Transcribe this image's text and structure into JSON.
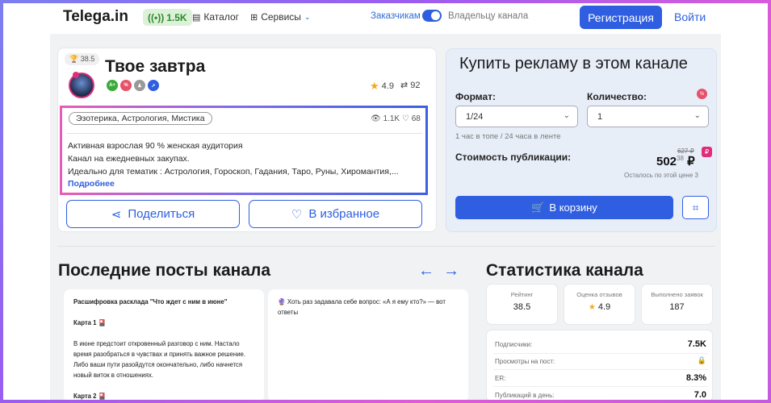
{
  "header": {
    "logo": "Telega.in",
    "subscribers": "1.5K",
    "catalog": "Каталог",
    "services": "Сервисы",
    "toggle_left": "Заказчикам",
    "toggle_right": "Владельцу канала",
    "register": "Регистрация",
    "login": "Войти"
  },
  "channel": {
    "rank": "38.5",
    "title": "Твое завтра",
    "rating": "4.9",
    "reposts": "92",
    "category": "Эзотерика, Астрология, Мистика",
    "views": "1.1K",
    "likes": "68",
    "description": [
      "Активная взрослая 90 % женская аудитория",
      "Канал на ежедневных закупах.",
      "Идеально для тематик : Астрология, Гороскоп, Гадания, Таро, Руны, Хиромантия,..."
    ],
    "more": "Подробнее",
    "share": "Поделиться",
    "favorite": "В избранное"
  },
  "buy": {
    "title": "Купить рекламу в этом канале",
    "format_label": "Формат:",
    "format_value": "1/24",
    "qty_label": "Количество:",
    "qty_value": "1",
    "format_hint": "1 час в топе / 24 часа в ленте",
    "cost_label": "Стоимость публикации:",
    "old_price": "627 ₽",
    "price": "502",
    "price_cents": "38",
    "currency": "₽",
    "remaining": "Осталось по этой цене 3",
    "cart": "В корзину"
  },
  "posts": {
    "heading": "Последние посты канала",
    "items": [
      {
        "lines": [
          "Расшифровка расклада \"Что ждет с ним в июне\"",
          "",
          "Карта 1 🎴",
          "",
          "В июне предстоит откровенный разговор с ним. Настало время разобраться в чувствах и принять важное решение. Либо ваши пути разойдутся окончательно, либо начнется новый виток в отношениях.",
          "",
          "Карта 2 🎴"
        ]
      },
      {
        "lines": [
          "🔮 Хоть раз задавала себе вопрос: «А я ему кто?» — вот ответы"
        ]
      }
    ]
  },
  "stats": {
    "heading": "Статистика канала",
    "cards": [
      {
        "title": "Рейтинг",
        "value": "38.5"
      },
      {
        "title": "Оценка отзывов",
        "value": "4.9"
      },
      {
        "title": "Выполнено заявок",
        "value": "187"
      }
    ],
    "rows": [
      {
        "label": "Подписчики:",
        "value": "7.5K"
      },
      {
        "label": "Просмотры на пост:",
        "value": ""
      },
      {
        "label": "ER:",
        "value": "8.3%"
      },
      {
        "label": "Публикаций в день:",
        "value": "7.0"
      }
    ]
  }
}
